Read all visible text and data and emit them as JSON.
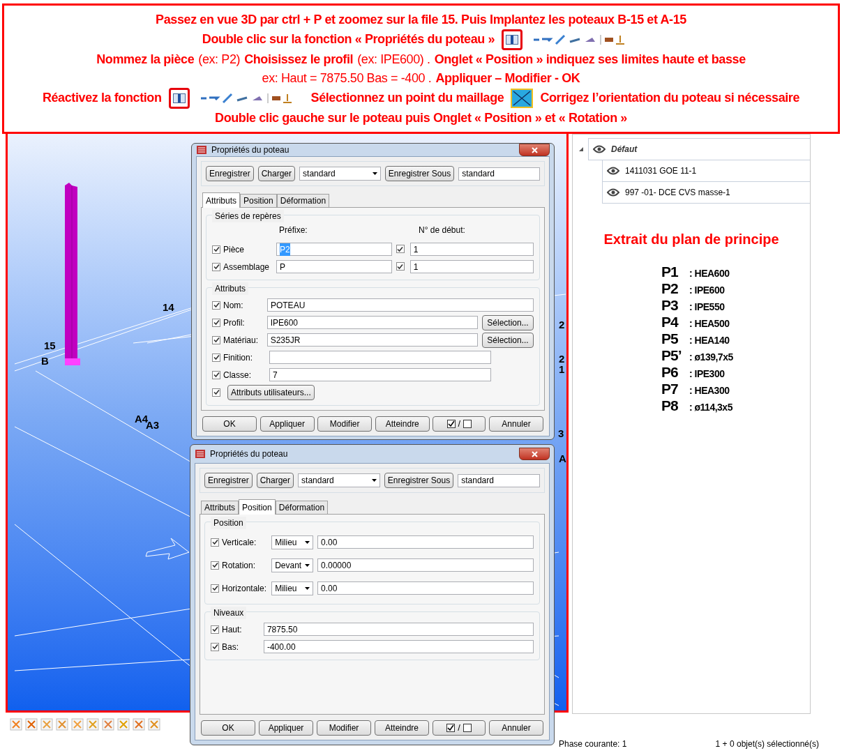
{
  "instructions": {
    "lines": [
      [
        {
          "kind": "text",
          "text": "Passez en vue 3D par ctrl + P et zoomez sur la file 15. Puis Implantez les poteaux B-15 et A-15",
          "bold": true
        }
      ],
      [
        {
          "kind": "text",
          "text": "Double clic sur la fonction  « Propriétés du poteau »",
          "bold": true
        },
        {
          "kind": "function_icon"
        },
        {
          "kind": "tool_strip"
        }
      ],
      [
        {
          "kind": "text",
          "text": "Nommez la pièce",
          "bold": true
        },
        {
          "kind": "text",
          "text": "(ex: P2)",
          "bold": false
        },
        {
          "kind": "text",
          "text": "Choisissez le profil",
          "bold": true
        },
        {
          "kind": "text",
          "text": "(ex: IPE600) .",
          "bold": false
        },
        {
          "kind": "text",
          "text": "Onglet « Position » indiquez ses limites haute et basse",
          "bold": true
        }
      ],
      [
        {
          "kind": "text",
          "text": "ex: Haut = 7875.50  Bas = -400 .",
          "bold": false
        },
        {
          "kind": "text",
          "text": "Appliquer – Modifier - OK",
          "bold": true
        }
      ],
      [
        {
          "kind": "text",
          "text": "Réactivez la fonction",
          "bold": true
        },
        {
          "kind": "function_icon"
        },
        {
          "kind": "tool_strip"
        },
        {
          "kind": "text",
          "text": "Sélectionnez un point du maillage",
          "bold": true
        },
        {
          "kind": "mesh_icon"
        },
        {
          "kind": "text",
          "text": "Corrigez l’orientation du poteau si nécessaire",
          "bold": true
        }
      ],
      [
        {
          "kind": "text",
          "text": "Double clic gauche sur le poteau puis Onglet « Position »  et « Rotation »",
          "bold": true
        }
      ]
    ]
  },
  "viewport": {
    "labels": [
      "14",
      "15",
      "B",
      "A4",
      "A3",
      "2",
      "2",
      "1",
      "3",
      "A"
    ]
  },
  "dialogs": [
    {
      "title": "Propriétés du poteau",
      "toolbar": {
        "save": "Enregistrer",
        "load": "Charger",
        "preset": "standard",
        "save_as": "Enregistrer Sous",
        "save_as_name": "standard"
      },
      "tabs": [
        {
          "label": "Attributs",
          "selected": true
        },
        {
          "label": "Position",
          "selected": false
        },
        {
          "label": "Déformation",
          "selected": false
        }
      ],
      "sections": [
        {
          "kind": "series",
          "title": "Séries de repères",
          "columns": [
            "Préfixe:",
            "N° de début:"
          ],
          "rows": [
            {
              "label": "Pièce",
              "checked": true,
              "prefix": "P2",
              "highlighted": true,
              "start_checked": true,
              "start": "1"
            },
            {
              "label": "Assemblage",
              "checked": true,
              "prefix": "P",
              "highlighted": false,
              "start_checked": true,
              "start": "1"
            }
          ]
        },
        {
          "kind": "attributes",
          "title": "Attributs",
          "rows": [
            {
              "label": "Nom:",
              "checked": true,
              "value": "POTEAU"
            },
            {
              "label": "Profil:",
              "checked": true,
              "value": "IPE600",
              "button": "Sélection..."
            },
            {
              "label": "Matériau:",
              "checked": true,
              "value": "S235JR",
              "button": "Sélection..."
            },
            {
              "label": "Finition:",
              "checked": true
            },
            {
              "label": "Classe:",
              "checked": true,
              "value": "7"
            }
          ],
          "user_attributes": {
            "checked": true,
            "label": "Attributs utilisateurs..."
          }
        }
      ],
      "buttons": [
        "OK",
        "Appliquer",
        "Modifier",
        "Atteindre",
        "/",
        "Annuler"
      ]
    },
    {
      "title": "Propriétés du poteau",
      "toolbar": {
        "save": "Enregistrer",
        "load": "Charger",
        "preset": "standard",
        "save_as": "Enregistrer Sous",
        "save_as_name": "standard"
      },
      "tabs": [
        {
          "label": "Attributs",
          "selected": false
        },
        {
          "label": "Position",
          "selected": true
        },
        {
          "label": "Déformation",
          "selected": false
        }
      ],
      "sections": [
        {
          "kind": "position",
          "title": "Position",
          "rows": [
            {
              "label": "Verticale:",
              "checked": true,
              "option": "Milieu",
              "value": "0.00"
            },
            {
              "label": "Rotation:",
              "checked": true,
              "option": "Devant",
              "value": "0.00000"
            },
            {
              "label": "Horizontale:",
              "checked": true,
              "option": "Milieu",
              "value": "0.00"
            }
          ]
        },
        {
          "kind": "levels",
          "title": "Niveaux",
          "rows": [
            {
              "label": "Haut:",
              "checked": true,
              "value": "7875.50"
            },
            {
              "label": "Bas:",
              "checked": true,
              "value": "-400.00"
            }
          ]
        }
      ],
      "buttons": [
        "OK",
        "Appliquer",
        "Modifier",
        "Atteindre",
        "/",
        "Annuler"
      ]
    }
  ],
  "tree": {
    "label": "Défaut",
    "expanded": true,
    "children": [
      {
        "label": "1411031 GOE 11-1"
      },
      {
        "label": "997 -01- DCE CVS masse-1"
      }
    ]
  },
  "plan_extract": {
    "title": "Extrait du plan de principe",
    "items": [
      {
        "code": "P1",
        "profile": ": HEA600"
      },
      {
        "code": "P2",
        "profile": ": IPE600"
      },
      {
        "code": "P3",
        "profile": ": IPE550"
      },
      {
        "code": "P4",
        "profile": ": HEA500"
      },
      {
        "code": "P5",
        "profile": ": HEA140"
      },
      {
        "code": "P5’",
        "profile": ": ø139,7x5"
      },
      {
        "code": "P6",
        "profile": ": IPE300"
      },
      {
        "code": "P7",
        "profile": ": HEA300"
      },
      {
        "code": "P8",
        "profile": ": ø114,3x5"
      }
    ]
  },
  "status_bar": {
    "phase": "Phase courante: 1",
    "selection": "1 + 0 objet(s) sélectionné(s)"
  }
}
